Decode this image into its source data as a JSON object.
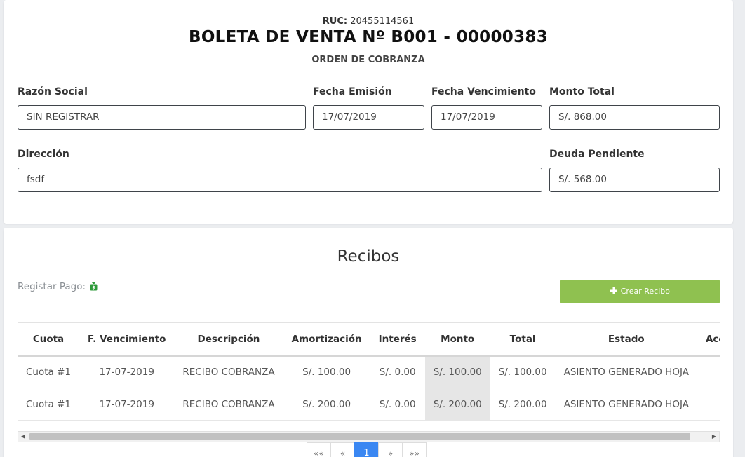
{
  "header": {
    "ruc_label": "RUC:",
    "ruc_value": "20455114561",
    "title": "BOLETA DE VENTA Nº B001 - 00000383",
    "subtitle": "ORDEN DE COBRANZA"
  },
  "form": {
    "razon_social": {
      "label": "Razón Social",
      "value": "SIN REGISTRAR"
    },
    "fecha_emision": {
      "label": "Fecha Emisión",
      "value": "17/07/2019"
    },
    "fecha_vencimiento": {
      "label": "Fecha Vencimiento",
      "value": "17/07/2019"
    },
    "monto_total": {
      "label": "Monto Total",
      "value": "S/. 868.00"
    },
    "direccion": {
      "label": "Dirección",
      "value": "fsdf"
    },
    "deuda_pendiente": {
      "label": "Deuda Pendiente",
      "value": "S/. 568.00"
    }
  },
  "recibos": {
    "title": "Recibos",
    "registrar_label": "Registar Pago:",
    "registrar_icon": "money-bag-icon",
    "crear_button": "Crear Recibo",
    "columns": [
      "Cuota",
      "F. Vencimiento",
      "Descripción",
      "Amortización",
      "Interés",
      "Monto",
      "Total",
      "Estado",
      "Acciones"
    ],
    "rows": [
      {
        "cuota": "Cuota #1",
        "vencimiento": "17-07-2019",
        "descripcion": "RECIBO COBRANZA",
        "amortizacion": "S/. 100.00",
        "interes": "S/. 0.00",
        "monto": "S/. 100.00",
        "total": "S/. 100.00",
        "estado": "ASIENTO GENERADO HOJA"
      },
      {
        "cuota": "Cuota #1",
        "vencimiento": "17-07-2019",
        "descripcion": "RECIBO COBRANZA",
        "amortizacion": "S/. 200.00",
        "interes": "S/. 0.00",
        "monto": "S/. 200.00",
        "total": "S/. 200.00",
        "estado": "ASIENTO GENERADO HOJA"
      }
    ]
  },
  "pagination": {
    "first": "««",
    "prev": "«",
    "current": "1",
    "next": "»",
    "last": "»»"
  },
  "colors": {
    "accent_green": "#8fc150",
    "active_page": "#3a87f2",
    "delete_red": "#c0392b",
    "icon_green": "#2e9a3a"
  }
}
